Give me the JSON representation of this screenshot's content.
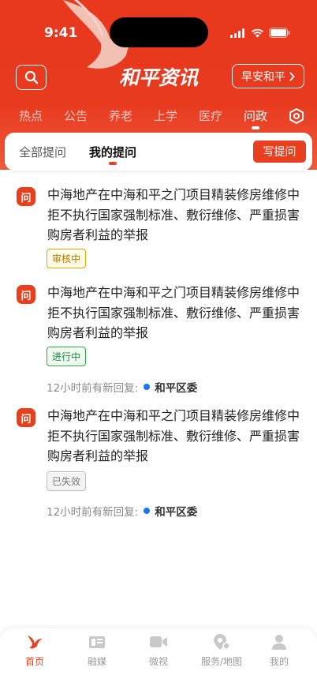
{
  "status_bar": {
    "time": "9:41"
  },
  "header": {
    "logo_text": "和平资讯",
    "greeting_button": "早安和平"
  },
  "category_tabs": [
    {
      "label": "热点",
      "active": false
    },
    {
      "label": "公告",
      "active": false
    },
    {
      "label": "养老",
      "active": false
    },
    {
      "label": "上学",
      "active": false
    },
    {
      "label": "医疗",
      "active": false
    },
    {
      "label": "问政",
      "active": true
    }
  ],
  "sub_tabs": [
    {
      "label": "全部提问",
      "active": false
    },
    {
      "label": "我的提问",
      "active": true
    }
  ],
  "ask_button": "写提问",
  "questions": [
    {
      "badge": "问",
      "title": "中海地产在中海和平之门项目精装修房维修中拒不执行国家强制标准、敷衍维修、严重损害购房者利益的举报",
      "status": "审核中",
      "status_color": "#e0a800",
      "reply_text": "",
      "reply_org": ""
    },
    {
      "badge": "问",
      "title": "中海地产在中海和平之门项目精装修房维修中拒不执行国家强制标准、敷衍维修、严重损害购房者利益的举报",
      "status": "进行中",
      "status_color": "#2da84a",
      "reply_text": "12小时前有新回复:",
      "reply_org": "和平区委"
    },
    {
      "badge": "问",
      "title": "中海地产在中海和平之门项目精装修房维修中拒不执行国家强制标准、敷衍维修、严重损害购房者利益的举报",
      "status": "已失效",
      "status_color": "#9a9a9a",
      "reply_text": "12小时前有新回复:",
      "reply_org": "和平区委"
    }
  ],
  "bottom_tabs": [
    {
      "label": "首页",
      "icon": "dove-icon",
      "active": true
    },
    {
      "label": "融媒",
      "icon": "media-icon",
      "active": false
    },
    {
      "label": "微视",
      "icon": "video-icon",
      "active": false
    },
    {
      "label": "服务/地图",
      "icon": "map-pin-icon",
      "active": false
    },
    {
      "label": "我的",
      "icon": "user-icon",
      "active": false
    }
  ],
  "colors": {
    "brand": "#e8401f",
    "reply_dot": "#1877e6"
  }
}
